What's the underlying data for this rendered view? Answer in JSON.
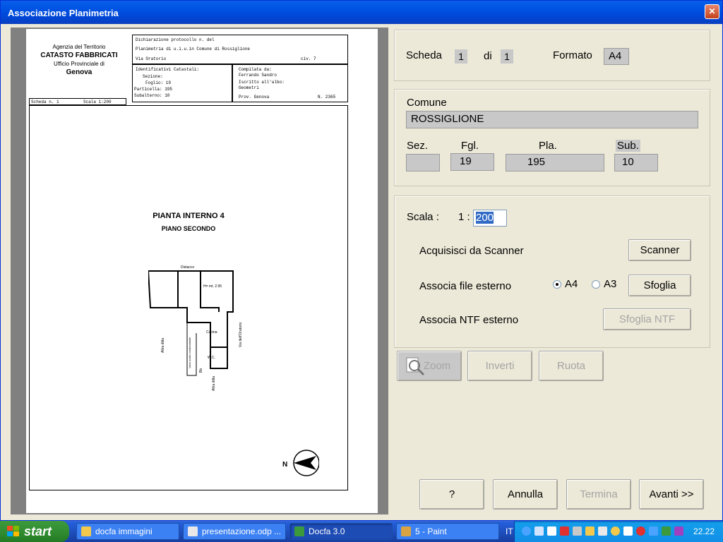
{
  "window": {
    "title": "Associazione Planimetria",
    "close_glyph": "✕"
  },
  "sheet": {
    "agency_line1": "Agenzia del Territorio",
    "agency_line2": "CATASTO FABBRICATI",
    "agency_line3": "Ufficio Provinciale di",
    "agency_line4": "Genova",
    "box1_line1": "Dichiarazione protocollo n.        del",
    "box1_line2": "Planimetria di u.i.u.in Comune di Rossiglione",
    "box1_line3": "Via Oratorio",
    "box1_civ": "civ. 7",
    "id_title": "Identificativi Catastali:",
    "id_sezione": "Sezione:",
    "id_foglio": "Foglio: 19",
    "id_particella": "Particella: 195",
    "id_subalterno": "Subalterno: 10",
    "comp_line1": "Compilata da:",
    "comp_line2": "Ferrando Sandro",
    "comp_line3": "Iscritto all'albo:",
    "comp_line4": "Geometri",
    "comp_prov": "Prov. Genova",
    "comp_num": "N. 2365",
    "scheda_label": "Scheda n. 1",
    "scala_label": "Scala 1:200",
    "plan_title": "PIANTA INTERNO 4",
    "plan_subtitle": "PIANO SECONDO",
    "lbl_distacco": "Distacco",
    "lbl_h": "H= mt. 2.95",
    "lbl_cucina": "Cucina",
    "lbl_wc": "W.C.",
    "lbl_altra_ditta": "Altra ditta",
    "lbl_vano_scala": "Vano scala condominiale",
    "lbl_via_oratorio": "Via dell'Oratorio",
    "lbl_bb": "Bb",
    "compass_n": "N"
  },
  "scheda": {
    "label": "Scheda",
    "value": "1",
    "di_label": "di",
    "total": "1",
    "formato_label": "Formato",
    "formato_value": "A4"
  },
  "comune": {
    "label": "Comune",
    "value": "ROSSIGLIONE",
    "sez_label": "Sez.",
    "sez_value": "",
    "fgl_label": "Fgl.",
    "fgl_value": "19",
    "pla_label": "Pla.",
    "pla_value": "195",
    "sub_label": "Sub.",
    "sub_value": "10"
  },
  "scala": {
    "label": "Scala :",
    "prefix": "1 :",
    "value": "200"
  },
  "acquisisci": {
    "label": "Acquisisci da Scanner",
    "button": "Scanner"
  },
  "file_esterno": {
    "label": "Associa file esterno",
    "opt_a4": "A4",
    "opt_a3": "A3",
    "selected": "A4",
    "button": "Sfoglia"
  },
  "ntf_esterno": {
    "label": "Associa NTF esterno",
    "button": "Sfoglia NTF"
  },
  "tools": {
    "zoom": "Zoom",
    "inverti": "Inverti",
    "ruota": "Ruota"
  },
  "footer": {
    "help": "?",
    "annulla": "Annulla",
    "termina": "Termina",
    "avanti": "Avanti >>"
  },
  "taskbar": {
    "start": "start",
    "tasks": [
      {
        "label": "docfa immagini",
        "icon_color": "#f2c94c"
      },
      {
        "label": "presentazione.odp ...",
        "icon_color": "#e8e8e8"
      },
      {
        "label": "Docfa 3.0",
        "icon_color": "#3c9a3c"
      },
      {
        "label": "5 - Paint",
        "icon_color": "#d9a441"
      }
    ],
    "lang": "IT",
    "clock": "22.22"
  }
}
